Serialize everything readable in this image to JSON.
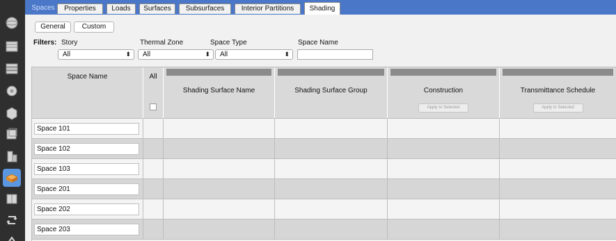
{
  "tabs": [
    {
      "label": "Spaces",
      "selected": false
    },
    {
      "label": "Properties",
      "selected": false
    },
    {
      "label": "Loads",
      "selected": false
    },
    {
      "label": "Surfaces",
      "selected": false
    },
    {
      "label": "Subsurfaces",
      "selected": false
    },
    {
      "label": "Interior Partitions",
      "selected": false
    },
    {
      "label": "Shading",
      "selected": true
    }
  ],
  "view_toggle": {
    "general": "General",
    "custom": "Custom"
  },
  "filters": {
    "label": "Filters:",
    "story": {
      "label": "Story",
      "value": "All"
    },
    "thermal_zone": {
      "label": "Thermal Zone",
      "value": "All"
    },
    "space_type": {
      "label": "Space Type",
      "value": "All"
    },
    "space_name": {
      "label": "Space Name",
      "value": ""
    }
  },
  "grid": {
    "headers": {
      "space_name": "Space Name",
      "all": "All",
      "shading_surface_name": "Shading Surface Name",
      "shading_surface_group": "Shading Surface Group",
      "construction": "Construction",
      "transmittance_schedule": "Transmittance Schedule"
    },
    "apply_label": "Apply to Selected",
    "rows": [
      {
        "space": "Space 101"
      },
      {
        "space": "Space 102"
      },
      {
        "space": "Space 103"
      },
      {
        "space": "Space 201"
      },
      {
        "space": "Space 202"
      },
      {
        "space": "Space 203"
      }
    ]
  },
  "sidebar_icons": [
    "site-icon",
    "schedules-icon",
    "constructions-icon",
    "loads-icon",
    "space-types-icon",
    "geometry-icon",
    "facility-icon",
    "spaces-icon",
    "thermal-zones-icon",
    "hvac-systems-icon",
    "output-variables-icon"
  ],
  "colors": {
    "tab_bar": "#4a77c7",
    "sidebar": "#2f2f2f",
    "active_icon": "#5a97e0"
  }
}
